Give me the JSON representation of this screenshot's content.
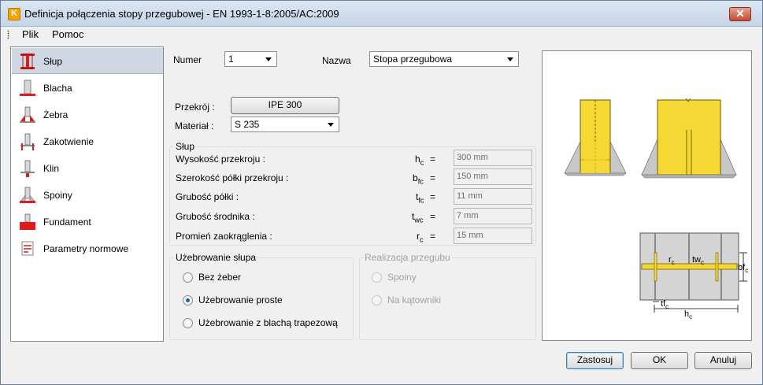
{
  "window": {
    "title": "Definicja połączenia stopy przegubowej - EN 1993-1-8:2005/AC:2009",
    "close_glyph": "✕"
  },
  "menu": {
    "items": [
      "Plik",
      "Pomoc"
    ]
  },
  "nav": {
    "items": [
      {
        "label": "Słup",
        "icon": "column-icon",
        "selected": true
      },
      {
        "label": "Blacha",
        "icon": "plate-icon"
      },
      {
        "label": "Żebra",
        "icon": "ribs-icon"
      },
      {
        "label": "Zakotwienie",
        "icon": "anchorage-icon"
      },
      {
        "label": "Klin",
        "icon": "wedge-icon"
      },
      {
        "label": "Spoiny",
        "icon": "welds-icon"
      },
      {
        "label": "Fundament",
        "icon": "foundation-icon"
      },
      {
        "label": "Parametry normowe",
        "icon": "code-parameters-icon"
      }
    ]
  },
  "form": {
    "numer_label": "Numer",
    "numer_value": "1",
    "nazwa_label": "Nazwa",
    "nazwa_value": "Stopa przegubowa",
    "przekroj_label": "Przekrój :",
    "przekroj_button": "IPE 300",
    "material_label": "Materiał :",
    "material_value": "S 235"
  },
  "column_group": {
    "title": "Słup",
    "rows": [
      {
        "label": "Wysokość przekroju :",
        "sym": "h",
        "sub": "c",
        "value": "300 mm"
      },
      {
        "label": "Szerokość półki przekroju :",
        "sym": "b",
        "sub": "fc",
        "value": "150 mm"
      },
      {
        "label": "Grubość półki :",
        "sym": "t",
        "sub": "fc",
        "value": "11 mm"
      },
      {
        "label": "Grubość środnika :",
        "sym": "t",
        "sub": "wc",
        "value": "7 mm"
      },
      {
        "label": "Promień zaokrąglenia :",
        "sym": "r",
        "sub": "c",
        "value": "15 mm"
      }
    ],
    "eq": "="
  },
  "stiffening_group": {
    "title": "Użebrowanie słupa",
    "options": [
      {
        "label": "Bez żeber",
        "checked": false
      },
      {
        "label": "Użebrowanie proste",
        "checked": true
      },
      {
        "label": "Użebrowanie z blachą trapezową",
        "checked": false
      }
    ]
  },
  "hinge_group": {
    "title": "Realizacja przegubu",
    "options": [
      {
        "label": "Spoiny",
        "checked": true
      },
      {
        "label": "Na kątowniki",
        "checked": false
      }
    ]
  },
  "drawing_labels": {
    "rc": "r",
    "rc_sub": "c",
    "twc": "tw",
    "twc_sub": "c",
    "bfc": "bf",
    "bfc_sub": "c",
    "tfc": "tf",
    "tfc_sub": "c",
    "hc": "h",
    "hc_sub": "c"
  },
  "buttons": {
    "apply": "Zastosuj",
    "ok": "OK",
    "cancel": "Anuluj"
  },
  "colors": {
    "steel_yellow": "#f5d834",
    "highlight_red": "#e01b1b",
    "selection_blue": "#cfd7e2"
  }
}
